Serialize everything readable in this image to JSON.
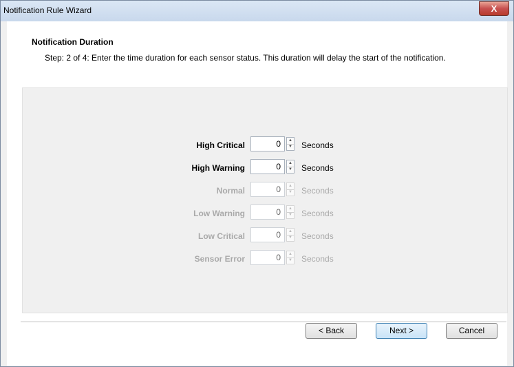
{
  "window": {
    "title": "Notification Rule Wizard",
    "close_label": "X"
  },
  "header": {
    "title": "Notification Duration",
    "subtitle": "Step: 2 of 4: Enter the time duration for each sensor status. This duration will delay the start of the notification."
  },
  "rows": [
    {
      "label": "High Critical",
      "value": "0",
      "unit": "Seconds",
      "enabled": true
    },
    {
      "label": "High Warning",
      "value": "0",
      "unit": "Seconds",
      "enabled": true
    },
    {
      "label": "Normal",
      "value": "0",
      "unit": "Seconds",
      "enabled": false
    },
    {
      "label": "Low Warning",
      "value": "0",
      "unit": "Seconds",
      "enabled": false
    },
    {
      "label": "Low Critical",
      "value": "0",
      "unit": "Seconds",
      "enabled": false
    },
    {
      "label": "Sensor Error",
      "value": "0",
      "unit": "Seconds",
      "enabled": false
    }
  ],
  "buttons": {
    "back": "< Back",
    "next": "Next >",
    "cancel": "Cancel"
  },
  "icons": {
    "spin_up": "caret-up-icon",
    "spin_down": "caret-down-icon"
  }
}
